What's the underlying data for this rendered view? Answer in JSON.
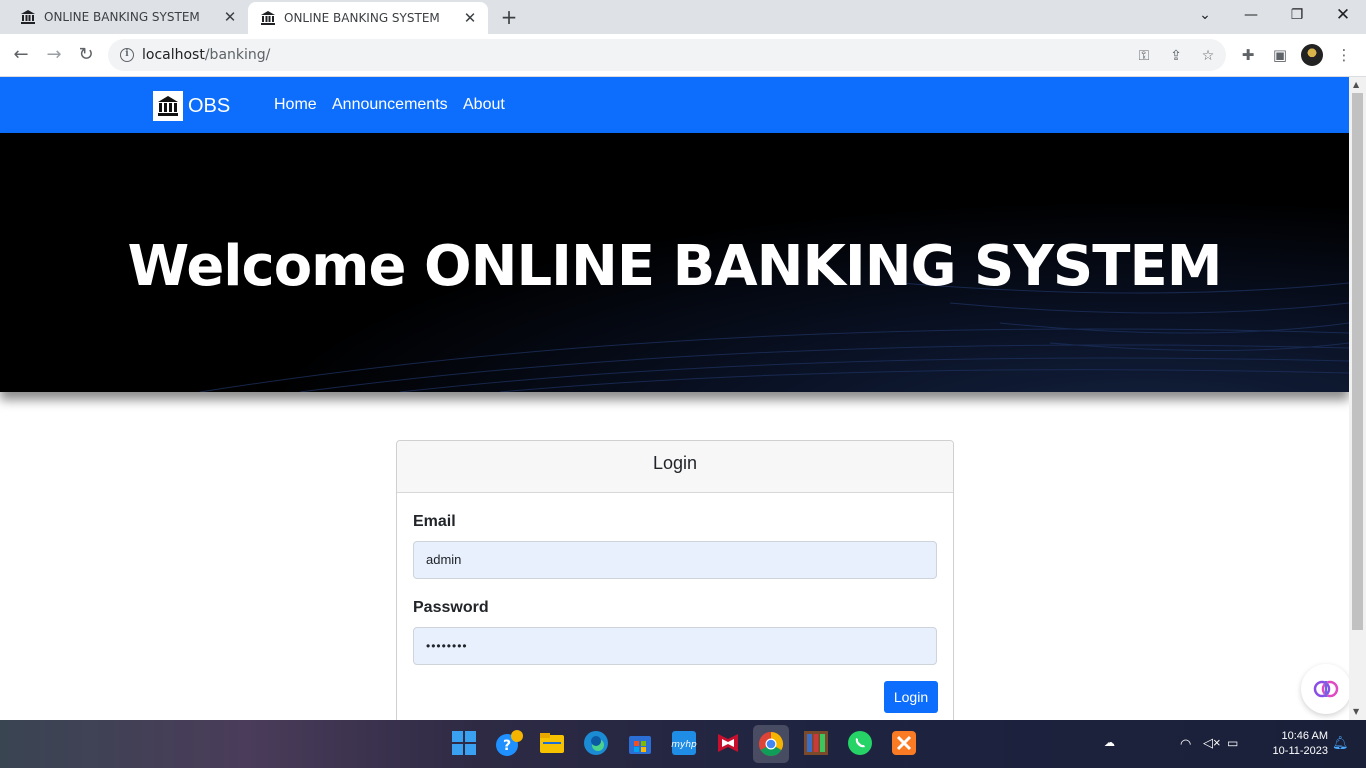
{
  "browser": {
    "tabs": [
      {
        "title": "ONLINE BANKING SYSTEM",
        "active": false
      },
      {
        "title": "ONLINE BANKING SYSTEM",
        "active": true
      }
    ],
    "url_host": "localhost",
    "url_path": "/banking/"
  },
  "navbar": {
    "brand": "OBS",
    "links": [
      "Home",
      "Announcements",
      "About"
    ]
  },
  "hero": {
    "title": "Welcome ONLINE BANKING SYSTEM"
  },
  "login": {
    "header": "Login",
    "email_label": "Email",
    "email_value": "admin",
    "password_label": "Password",
    "password_value": "••••••••",
    "button": "Login"
  },
  "taskbar": {
    "time": "10:46 AM",
    "date": "10-11-2023"
  },
  "colors": {
    "navbar": "#0d6efd",
    "button": "#0d6efd",
    "hero_bg": "#000000"
  },
  "icons": [
    "bank-icon",
    "close-icon",
    "plus-icon",
    "back-icon",
    "forward-icon",
    "reload-icon",
    "info-icon",
    "key-icon",
    "share-icon",
    "star-icon",
    "extensions-icon",
    "sidepanel-icon",
    "menu-icon"
  ]
}
